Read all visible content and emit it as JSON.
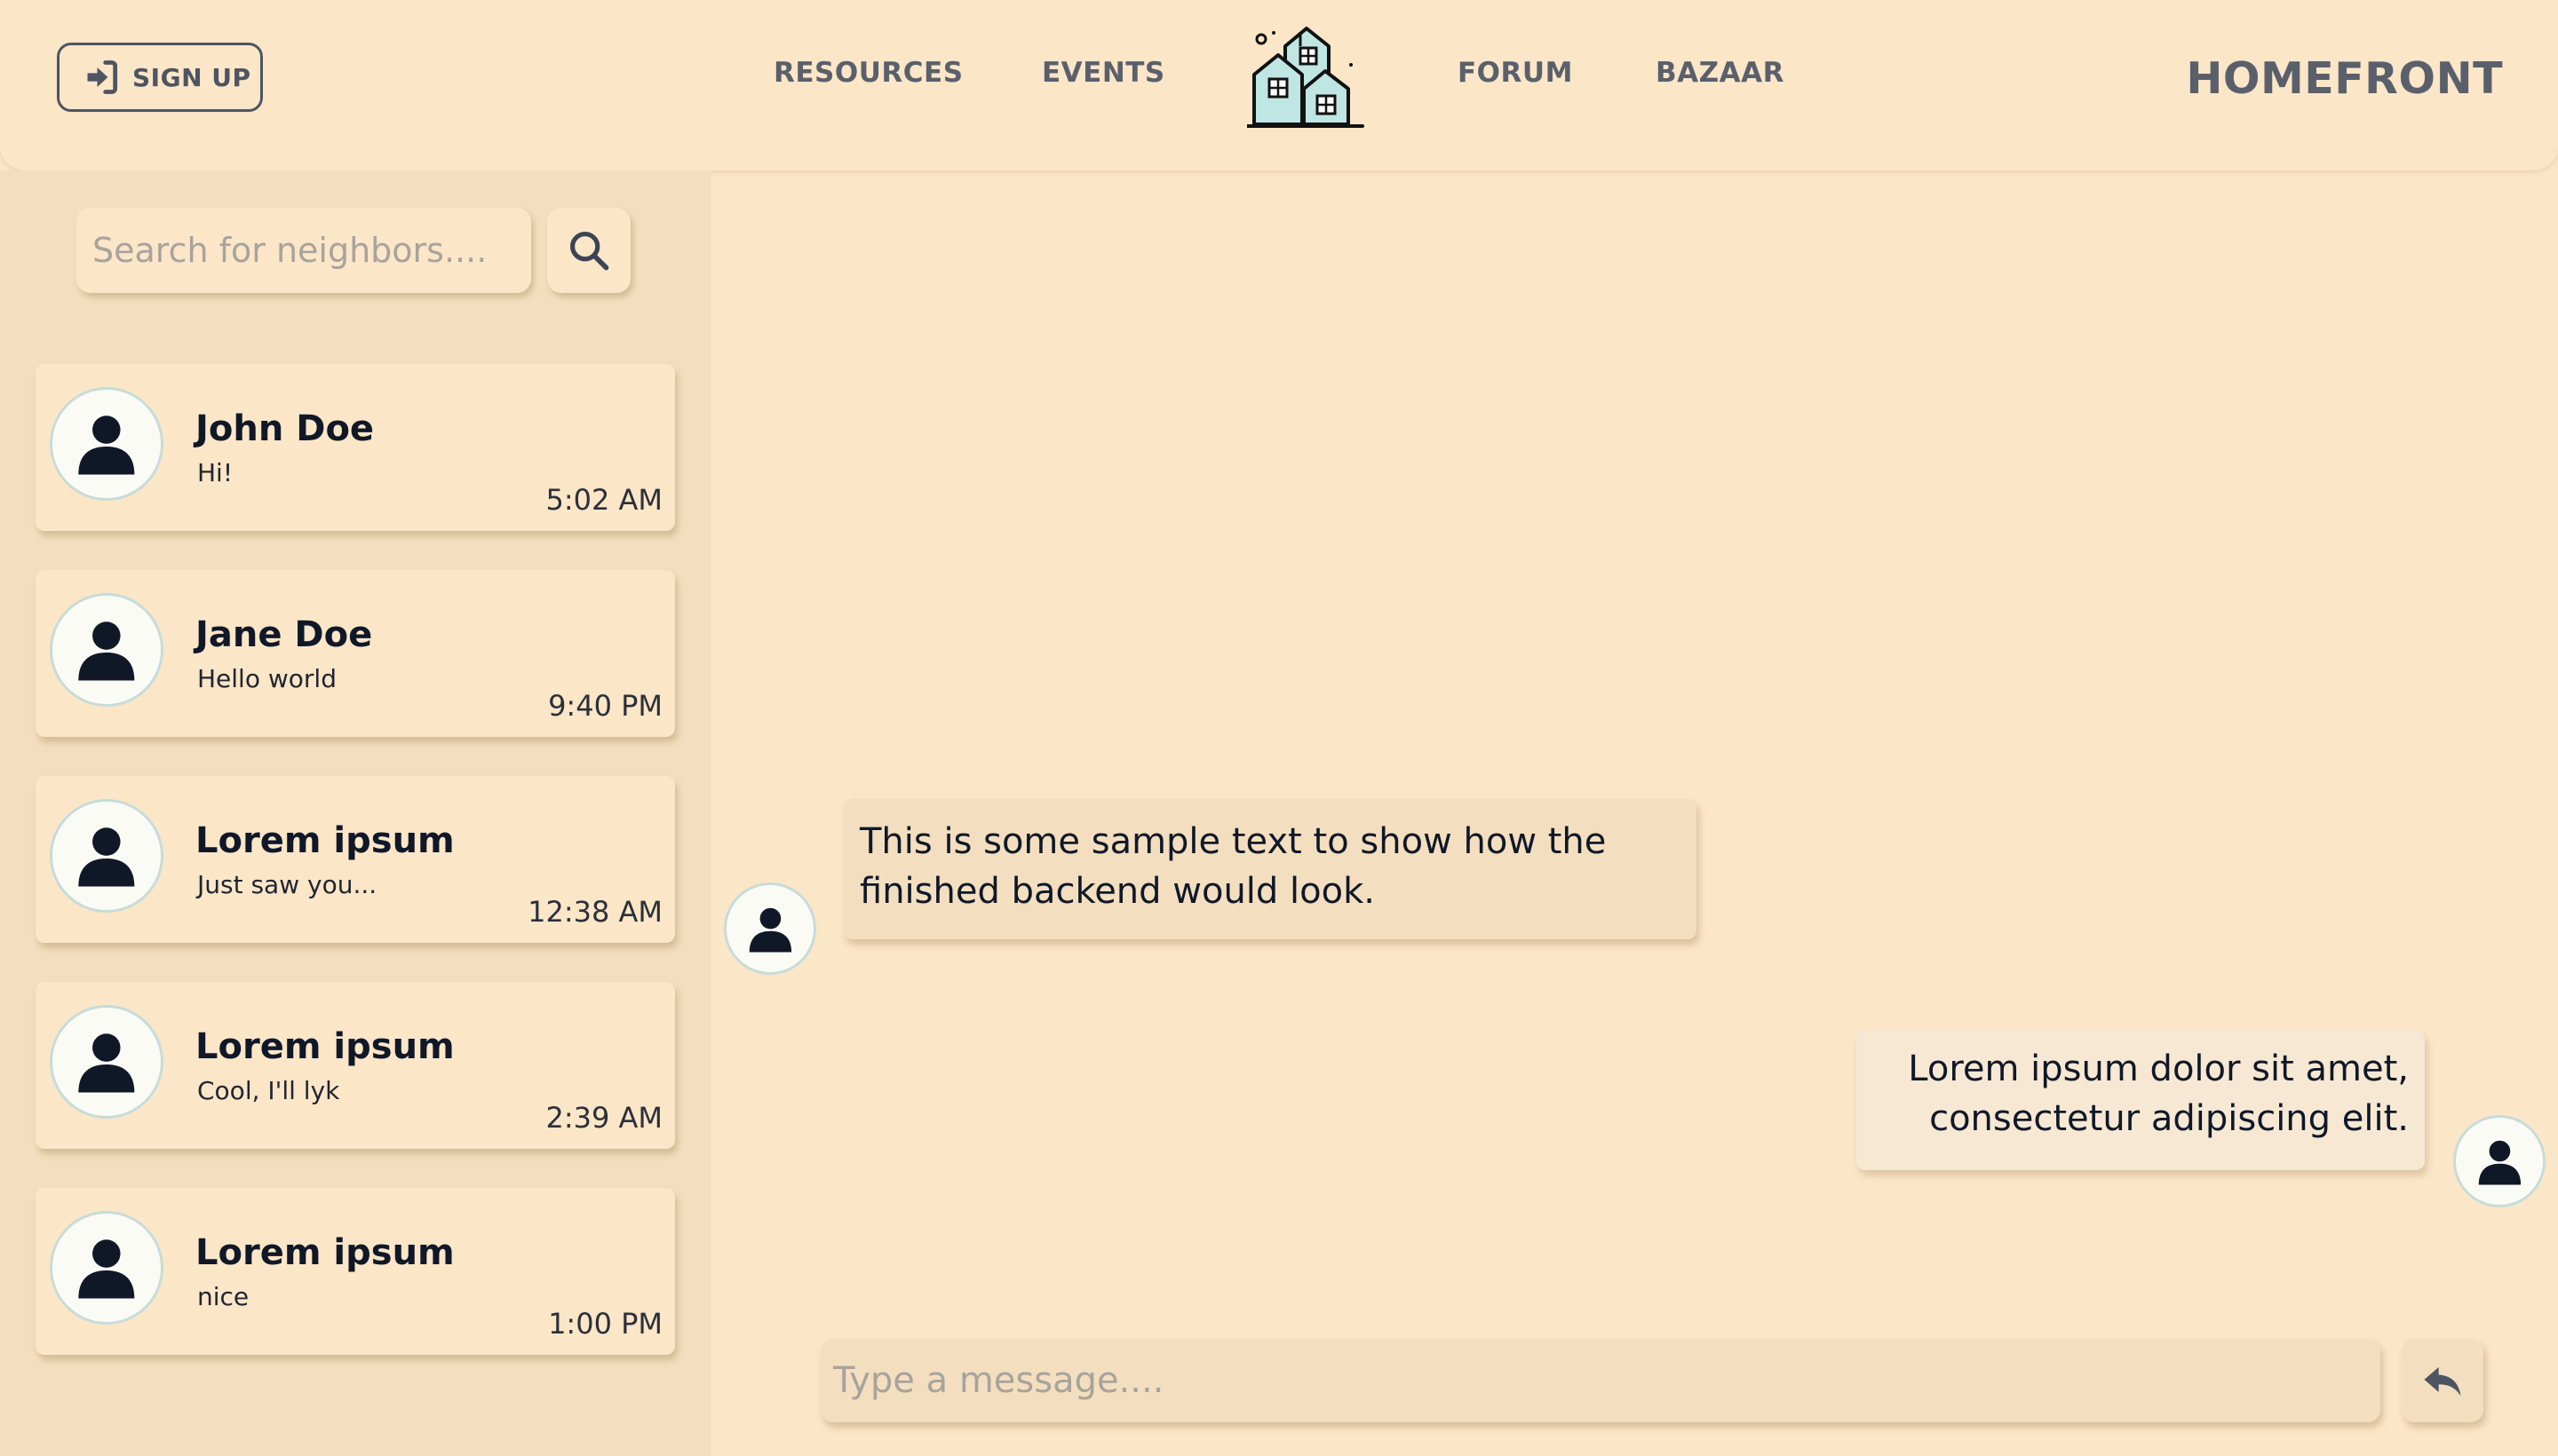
{
  "header": {
    "signup_label": "SIGN UP",
    "nav": [
      "RESOURCES",
      "EVENTS",
      "FORUM",
      "BAZAAR"
    ],
    "brand": "HOMEFRONT",
    "logo_icon": "houses-logo-icon"
  },
  "sidebar": {
    "search_placeholder": "Search for neighbors....",
    "search_icon": "search-icon",
    "contacts": [
      {
        "name": "John Doe",
        "preview": "Hi!",
        "time": "5:02 AM"
      },
      {
        "name": "Jane Doe",
        "preview": "Hello world",
        "time": "9:40 PM"
      },
      {
        "name": "Lorem ipsum",
        "preview": "Just saw you...",
        "time": "12:38 AM"
      },
      {
        "name": "Lorem ipsum",
        "preview": "Cool, I'll lyk",
        "time": "2:39 AM"
      },
      {
        "name": "Lorem ipsum",
        "preview": "nice",
        "time": "1:00 PM"
      }
    ]
  },
  "chat": {
    "messages": [
      {
        "direction": "incoming",
        "text": "This is some sample text to show how the finished backend would look."
      },
      {
        "direction": "outgoing",
        "text": "Lorem ipsum dolor sit amet, consectetur adipiscing elit."
      }
    ],
    "input_placeholder": "Type a message....",
    "send_icon": "reply-arrow-icon"
  },
  "colors": {
    "background": "#fbe6c8",
    "sidebar": "#f3dfbf",
    "nav_text": "#5a606b",
    "avatar_border": "#c7dcd8",
    "logo_accent": "#bfe6e3"
  }
}
